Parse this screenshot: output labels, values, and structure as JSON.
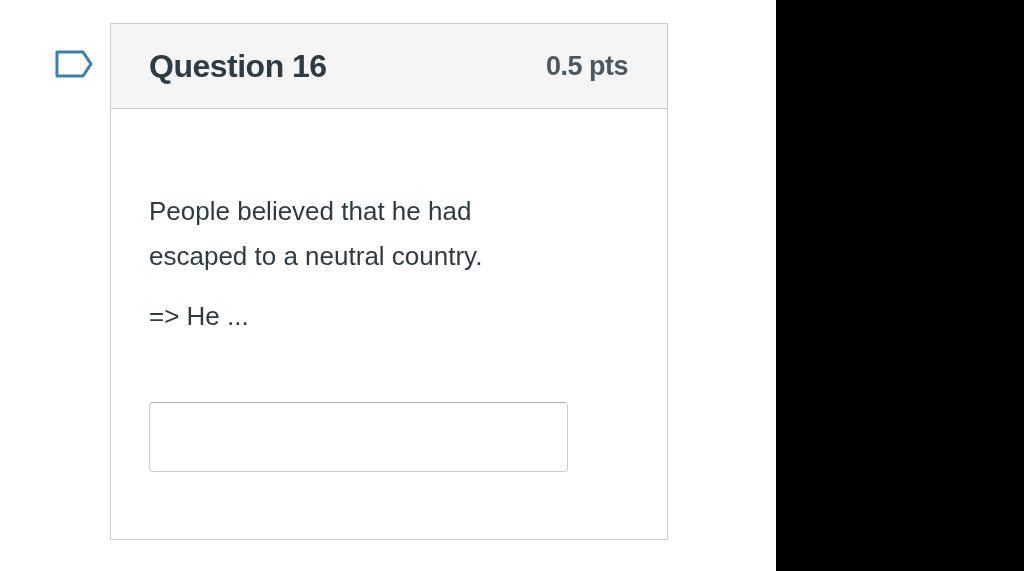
{
  "question": {
    "title": "Question 16",
    "points": "0.5 pts",
    "flagged": false,
    "text": "People believed that he had escaped to a neutral country.",
    "prompt": "=> He ..."
  }
}
